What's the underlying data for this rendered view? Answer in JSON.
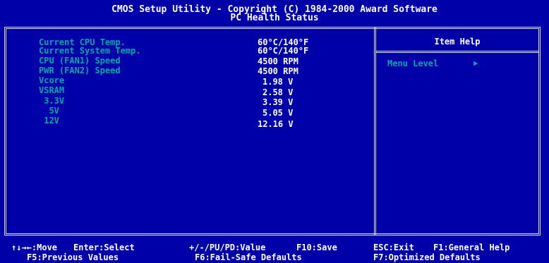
{
  "title": {
    "line1": "CMOS Setup Utility - Copyright (C) 1984-2000 Award Software",
    "line2": "PC Health Status"
  },
  "readings": [
    {
      "label": "Current CPU Temp.",
      "value": "60°C/140°F"
    },
    {
      "label": "Current System Temp.",
      "value": "60°C/140°F"
    },
    {
      "label": "CPU (FAN1) Speed",
      "value": "4500 RPM"
    },
    {
      "label": "PWR (FAN2) Speed",
      "value": "4500 RPM"
    },
    {
      "label": "Vcore",
      "value": "1.98 V"
    },
    {
      "label": "VSRAM",
      "value": "2.58 V"
    },
    {
      "label": " 3.3V",
      "value": "3.39 V"
    },
    {
      "label": "  5V",
      "value": "5.05 V"
    },
    {
      "label": " 12V",
      "value": "12.16 V"
    }
  ],
  "help": {
    "title": "Item Help",
    "menu_level": "Menu Level",
    "menu_level_arrow": "▶"
  },
  "keys": {
    "move": "↑↓→←:Move",
    "select": "Enter:Select",
    "value": "+/-/PU/PD:Value",
    "save": "F10:Save",
    "exit": "ESC:Exit",
    "general_help": "F1:General Help",
    "previous_values": "F5:Previous Values",
    "fail_safe": "F6:Fail-Safe Defaults",
    "optimized": "F7:Optimized Defaults"
  },
  "colors": {
    "background": "#0000a8",
    "label": "#00a8a8",
    "value": "#ffffff",
    "frame": "#dcdcdc"
  }
}
